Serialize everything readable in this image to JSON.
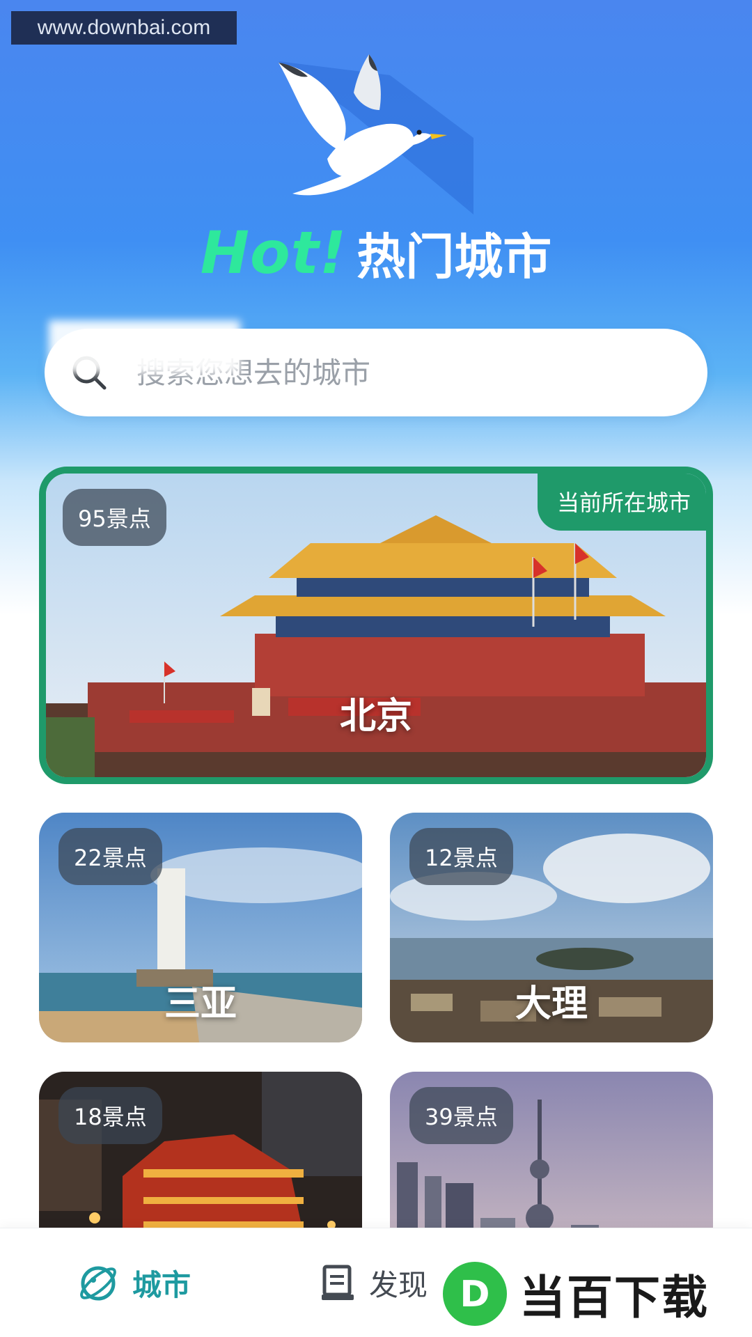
{
  "watermark_top": "www.downbai.com",
  "hero": {
    "hot": "Hot!",
    "title": "热门城市"
  },
  "search": {
    "placeholder": "搜索您想去的城市"
  },
  "featured": {
    "spots": "95景点",
    "city": "北京",
    "current_tag": "当前所在城市"
  },
  "cards": [
    {
      "spots": "22景点",
      "city": "三亚"
    },
    {
      "spots": "12景点",
      "city": "大理"
    },
    {
      "spots": "18景点",
      "city": ""
    },
    {
      "spots": "39景点",
      "city": ""
    }
  ],
  "tabbar": {
    "items": [
      {
        "label": "城市",
        "icon": "planet-icon",
        "active": true
      },
      {
        "label": "发现",
        "icon": "document-icon",
        "active": false
      }
    ]
  },
  "brand_watermark": {
    "text": "当百下载",
    "logo_letter": "D"
  },
  "colors": {
    "accent_green": "#1f9a6a",
    "active_tab": "#1e9aa0",
    "hot_green": "#2ee89c"
  }
}
